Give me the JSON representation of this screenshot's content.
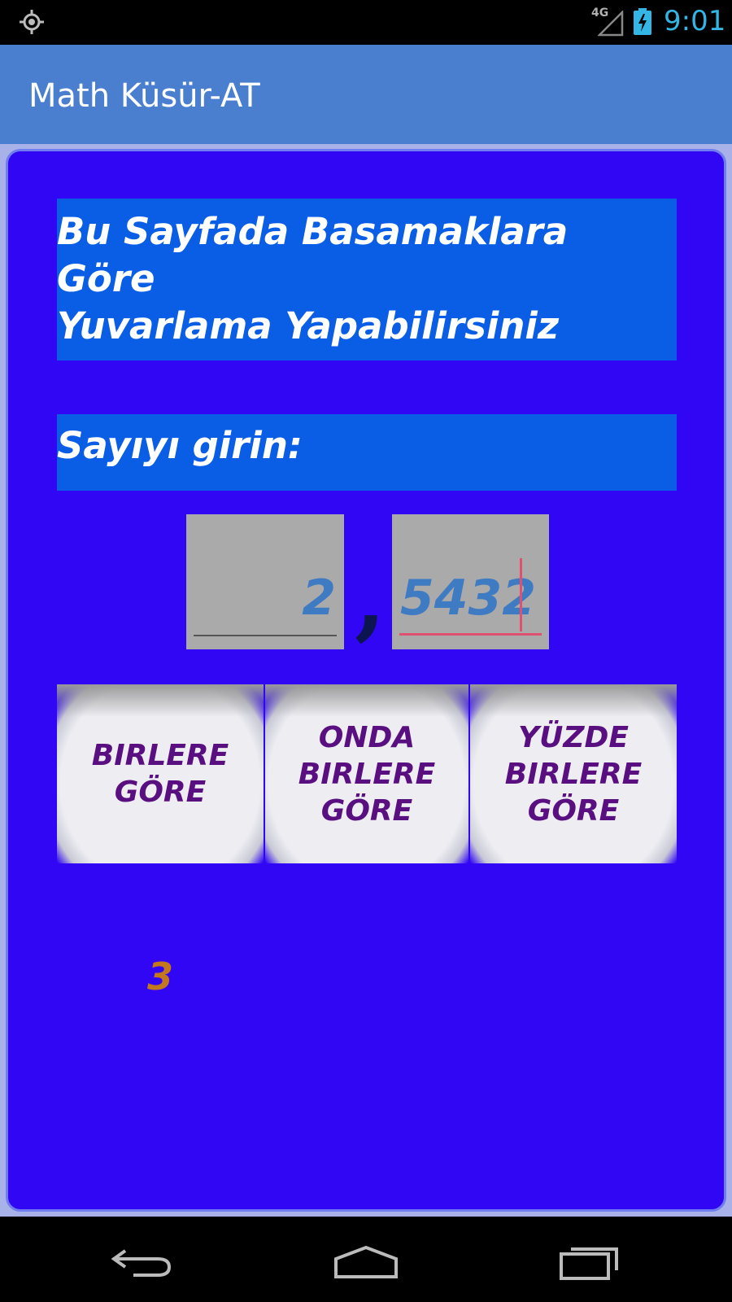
{
  "status_bar": {
    "network": "4G",
    "time": "9:01",
    "icons": [
      "location-icon",
      "signal-icon",
      "battery-charging-icon"
    ]
  },
  "app_bar": {
    "title": "Math Küsür-AT"
  },
  "main": {
    "heading_line1": "Bu Sayfada Basamaklara Göre",
    "heading_line2": "Yuvarlama Yapabilirsiniz",
    "prompt": "Sayıyı girin:",
    "integer_value": "2",
    "decimal_separator": ",",
    "decimal_value": "5432",
    "buttons": [
      {
        "line1": "BIRLERE",
        "line2": "GÖRE",
        "line3": ""
      },
      {
        "line1": "ONDA",
        "line2": "BIRLERE",
        "line3": "GÖRE"
      },
      {
        "line1": "YÜZDE",
        "line2": "BIRLERE",
        "line3": "GÖRE"
      }
    ],
    "result": "3"
  },
  "nav_bar": {
    "icons": [
      "back-icon",
      "home-icon",
      "recents-icon"
    ]
  },
  "colors": {
    "app_bar": "#4a7fcf",
    "panel": "#3006f5",
    "label_box": "#0a5ee6",
    "button_text": "#5a0f80",
    "result_text": "#c4781e",
    "input_text": "#3e7bc2",
    "clock": "#33b5e5"
  }
}
